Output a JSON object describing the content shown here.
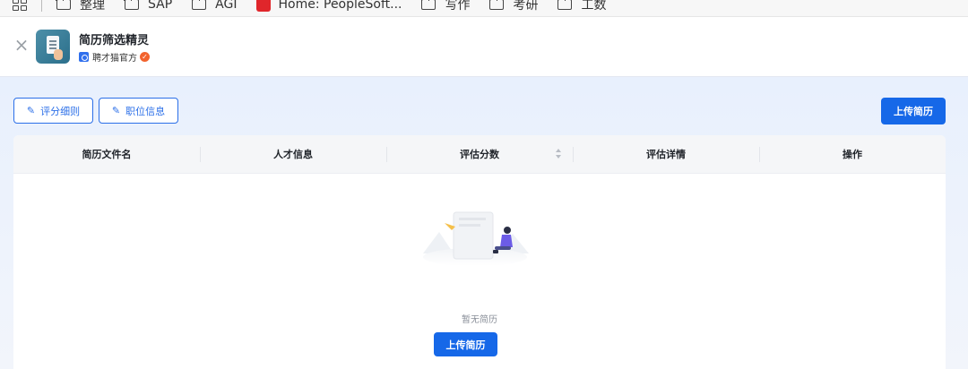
{
  "bookmarks": {
    "items": [
      {
        "label": "整理",
        "icon": "folder-icon"
      },
      {
        "label": "SAP",
        "icon": "folder-icon"
      },
      {
        "label": "AGI",
        "icon": "folder-icon"
      },
      {
        "label": "Home: PeopleSoft...",
        "icon": "peoplesoft-icon"
      },
      {
        "label": "写作",
        "icon": "folder-icon"
      },
      {
        "label": "考研",
        "icon": "folder-icon"
      },
      {
        "label": "工数",
        "icon": "folder-icon"
      }
    ]
  },
  "header": {
    "close_icon": "close-icon",
    "app_title": "简历筛选精灵",
    "author": "聘才猫官方",
    "verified_icon": "verified-badge-icon"
  },
  "toolbar": {
    "scoring_rules_label": "评分细则",
    "job_info_label": "职位信息",
    "upload_label": "上传简历"
  },
  "table": {
    "columns": [
      "简历文件名",
      "人才信息",
      "评估分数",
      "评估详情",
      "操作"
    ],
    "sortable_column": "评估分数",
    "rows": []
  },
  "empty_state": {
    "text": "暂无简历",
    "upload_label": "上传简历"
  },
  "colors": {
    "primary": "#1668e8",
    "header_bg": "#f5f6f8",
    "page_bg": "#e8f0fd"
  }
}
